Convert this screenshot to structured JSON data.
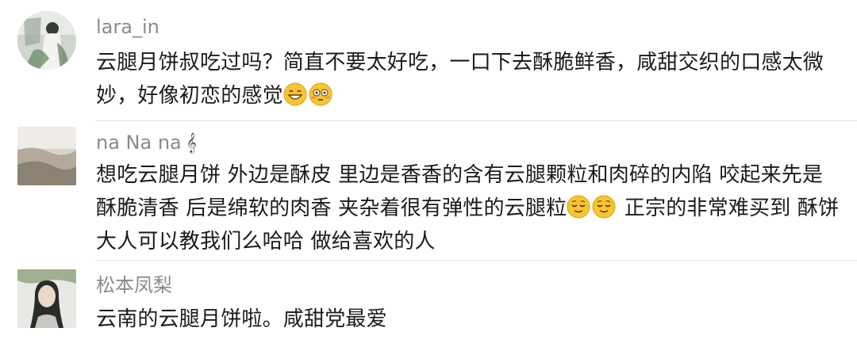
{
  "comments": [
    {
      "username": "lara_in",
      "text": "云腿月饼叔吃过吗？简直不要太好吃，一口下去酥脆鲜香，咸甜交织的口感太微妙，好像初恋的感觉",
      "emojis": [
        "grinning-face",
        "flushed-face"
      ]
    },
    {
      "username": "na Na na",
      "username_icon": "𝄞",
      "text_part1": "想吃云腿月饼 外边是酥皮 里边是香香的含有云腿颗粒和肉碎的内陷 咬起来先是酥脆清香 后是绵软的肉香 夹杂着很有弹性的云腿粒",
      "text_part2": " 正宗的非常难买到 酥饼大人可以教我们么哈哈 做给喜欢的人",
      "emojis": [
        "relieved-face",
        "relieved-face"
      ]
    },
    {
      "username": "松本凤梨",
      "text": "云南的云腿月饼啦。咸甜党最爱"
    }
  ],
  "colors": {
    "username": "#8b8b8b",
    "text": "#1b1b1b",
    "divider": "#e4e4e4",
    "emoji_face": "#f7c531"
  }
}
